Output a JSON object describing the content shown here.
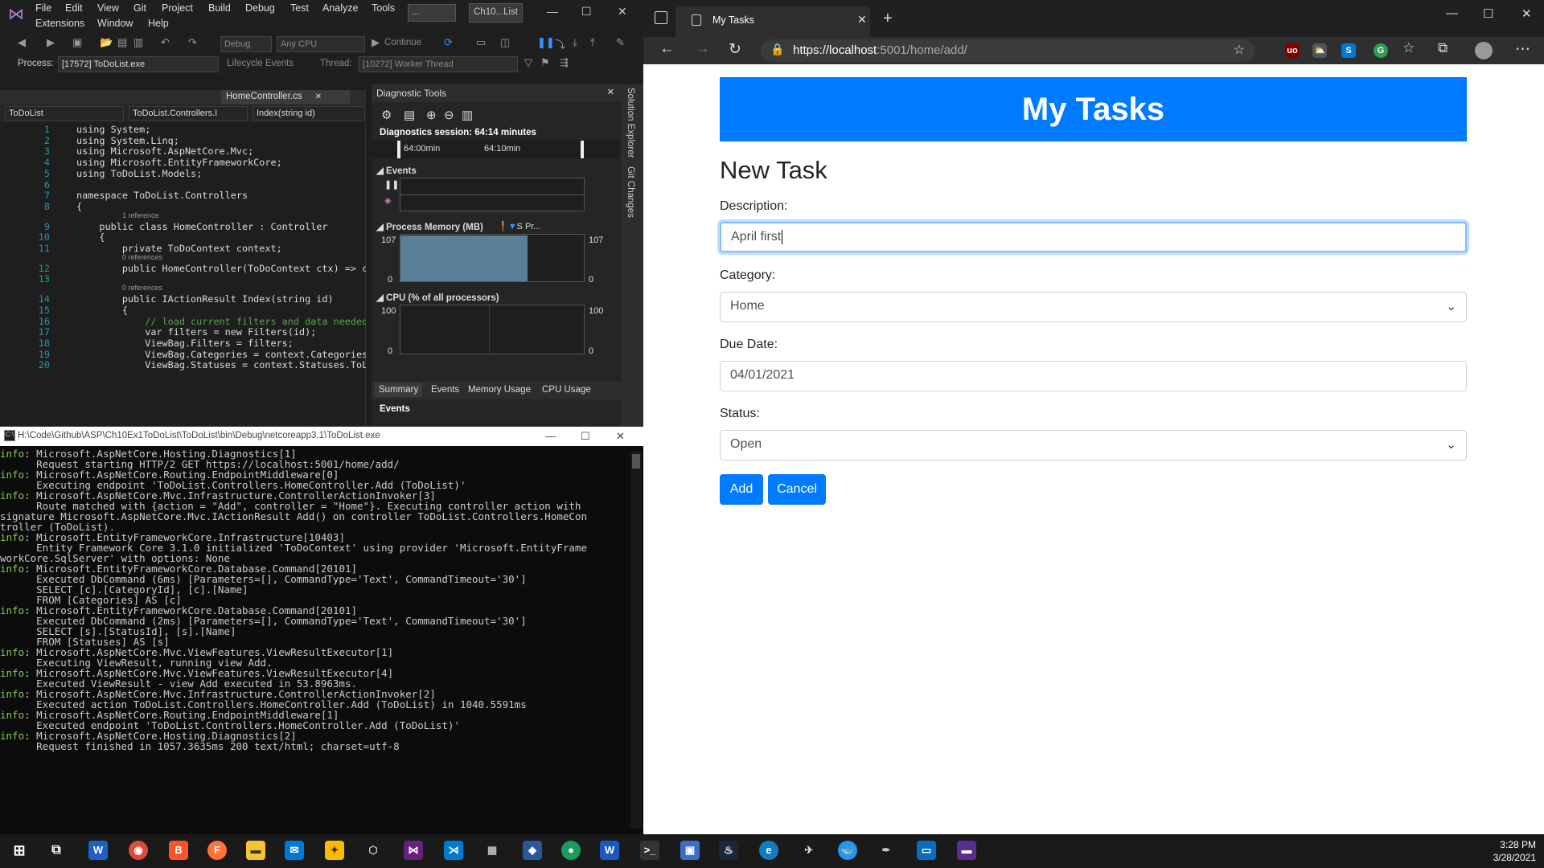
{
  "vs": {
    "menu": [
      "File",
      "Edit",
      "View",
      "Git",
      "Project",
      "Build",
      "Debug",
      "Test",
      "Analyze",
      "Tools",
      "Extensions",
      "Window",
      "Help"
    ],
    "search_label": "...",
    "solution_name": "Ch10...List",
    "toolbar": {
      "config": "Debug",
      "platform": "Any CPU",
      "continue_label": "Continue"
    },
    "toolbar2": {
      "process_label": "Process:",
      "process_value": "[17572] ToDoList.exe",
      "lifecycle_label": "Lifecycle Events",
      "thread_label": "Thread:",
      "thread_value": "[10272] Worker Thread"
    },
    "editor": {
      "tab_label": "HomeController.cs",
      "nav": [
        "ToDoList",
        "ToDoList.Controllers.I",
        "Index(string id)"
      ],
      "lines": [
        {
          "n": "1",
          "text": "using System;"
        },
        {
          "n": "2",
          "text": "using System.Linq;"
        },
        {
          "n": "3",
          "text": "using Microsoft.AspNetCore.Mvc;"
        },
        {
          "n": "4",
          "text": "using Microsoft.EntityFrameworkCore;"
        },
        {
          "n": "5",
          "text": "using ToDoList.Models;"
        },
        {
          "n": "6",
          "text": ""
        },
        {
          "n": "7",
          "text": "namespace ToDoList.Controllers"
        },
        {
          "n": "8",
          "text": "{"
        },
        {
          "n": "9",
          "text": "    public class HomeController : Controller",
          "hint": "1 reference"
        },
        {
          "n": "10",
          "text": "    {"
        },
        {
          "n": "11",
          "text": "        private ToDoContext context;"
        },
        {
          "n": "12",
          "text": "        public HomeController(ToDoContext ctx) => c",
          "hint": "0 references"
        },
        {
          "n": "13",
          "text": ""
        },
        {
          "n": "14",
          "text": "        public IActionResult Index(string id)",
          "hint": "0 references"
        },
        {
          "n": "15",
          "text": "        {"
        },
        {
          "n": "16",
          "text": "            // load current filters and data needed"
        },
        {
          "n": "17",
          "text": "            var filters = new Filters(id);"
        },
        {
          "n": "18",
          "text": "            ViewBag.Filters = filters;"
        },
        {
          "n": "19",
          "text": "            ViewBag.Categories = context.Categories"
        },
        {
          "n": "20",
          "text": "            ViewBag.Statuses = context.Statuses.ToL"
        }
      ]
    },
    "diag": {
      "title": "Diagnostic Tools",
      "session": "Diagnostics session: 64:14 minutes",
      "time1": "64:00min",
      "time2": "64:10min",
      "events_label": "Events",
      "memory_label": "Process Memory (MB)",
      "memory_legend": "S   Pr...",
      "mem_max": "107",
      "mem_min": "0",
      "cpu_label": "CPU (% of all processors)",
      "cpu_max": "100",
      "cpu_min": "0",
      "tabs": [
        "Summary",
        "Events",
        "Memory Usage",
        "CPU Usage"
      ],
      "bottom_events": "Events"
    },
    "side_tabs": [
      "Solution Explorer",
      "Git Changes"
    ]
  },
  "console": {
    "title": "H:\\Code\\Github\\ASP\\Ch10Ex1ToDoList\\ToDoList\\bin\\Debug\\netcoreapp3.1\\ToDoList.exe",
    "lines": [
      {
        "info": true,
        "text": "Microsoft.AspNetCore.Hosting.Diagnostics[1]"
      },
      {
        "info": false,
        "text": "      Request starting HTTP/2 GET https://localhost:5001/home/add/"
      },
      {
        "info": true,
        "text": "Microsoft.AspNetCore.Routing.EndpointMiddleware[0]"
      },
      {
        "info": false,
        "text": "      Executing endpoint 'ToDoList.Controllers.HomeController.Add (ToDoList)'"
      },
      {
        "info": true,
        "text": "Microsoft.AspNetCore.Mvc.Infrastructure.ControllerActionInvoker[3]"
      },
      {
        "info": false,
        "text": "      Route matched with {action = \"Add\", controller = \"Home\"}. Executing controller action with"
      },
      {
        "info": false,
        "text": "signature Microsoft.AspNetCore.Mvc.IActionResult Add() on controller ToDoList.Controllers.HomeCon"
      },
      {
        "info": false,
        "text": "troller (ToDoList)."
      },
      {
        "info": true,
        "text": "Microsoft.EntityFrameworkCore.Infrastructure[10403]"
      },
      {
        "info": false,
        "text": "      Entity Framework Core 3.1.0 initialized 'ToDoContext' using provider 'Microsoft.EntityFrame"
      },
      {
        "info": false,
        "text": "workCore.SqlServer' with options: None"
      },
      {
        "info": true,
        "text": "Microsoft.EntityFrameworkCore.Database.Command[20101]"
      },
      {
        "info": false,
        "text": "      Executed DbCommand (6ms) [Parameters=[], CommandType='Text', CommandTimeout='30']"
      },
      {
        "info": false,
        "text": "      SELECT [c].[CategoryId], [c].[Name]"
      },
      {
        "info": false,
        "text": "      FROM [Categories] AS [c]"
      },
      {
        "info": true,
        "text": "Microsoft.EntityFrameworkCore.Database.Command[20101]"
      },
      {
        "info": false,
        "text": "      Executed DbCommand (2ms) [Parameters=[], CommandType='Text', CommandTimeout='30']"
      },
      {
        "info": false,
        "text": "      SELECT [s].[StatusId], [s].[Name]"
      },
      {
        "info": false,
        "text": "      FROM [Statuses] AS [s]"
      },
      {
        "info": true,
        "text": "Microsoft.AspNetCore.Mvc.ViewFeatures.ViewResultExecutor[1]"
      },
      {
        "info": false,
        "text": "      Executing ViewResult, running view Add."
      },
      {
        "info": true,
        "text": "Microsoft.AspNetCore.Mvc.ViewFeatures.ViewResultExecutor[4]"
      },
      {
        "info": false,
        "text": "      Executed ViewResult - view Add executed in 53.8963ms."
      },
      {
        "info": true,
        "text": "Microsoft.AspNetCore.Mvc.Infrastructure.ControllerActionInvoker[2]"
      },
      {
        "info": false,
        "text": "      Executed action ToDoList.Controllers.HomeController.Add (ToDoList) in 1040.5591ms"
      },
      {
        "info": true,
        "text": "Microsoft.AspNetCore.Routing.EndpointMiddleware[1]"
      },
      {
        "info": false,
        "text": "      Executed endpoint 'ToDoList.Controllers.HomeController.Add (ToDoList)'"
      },
      {
        "info": true,
        "text": "Microsoft.AspNetCore.Hosting.Diagnostics[2]"
      },
      {
        "info": false,
        "text": "      Request finished in 1057.3635ms 200 text/html; charset=utf-8"
      }
    ]
  },
  "browser": {
    "tab_title": "My Tasks",
    "url_host": "https://localhost",
    "url_rest": ":5001/home/add/",
    "page": {
      "header": "My Tasks",
      "heading": "New Task",
      "description_label": "Description:",
      "description_value": "April first",
      "category_label": "Category:",
      "category_value": "Home",
      "due_label": "Due Date:",
      "due_value": "04/01/2021",
      "status_label": "Status:",
      "status_value": "Open",
      "add_label": "Add",
      "cancel_label": "Cancel"
    }
  },
  "taskbar": {
    "time": "3:28 PM",
    "date": "3/28/2021"
  },
  "colors": {
    "accent": "#007bff",
    "vs_purple": "#b180d7",
    "console_info": "#7ecf4a"
  }
}
